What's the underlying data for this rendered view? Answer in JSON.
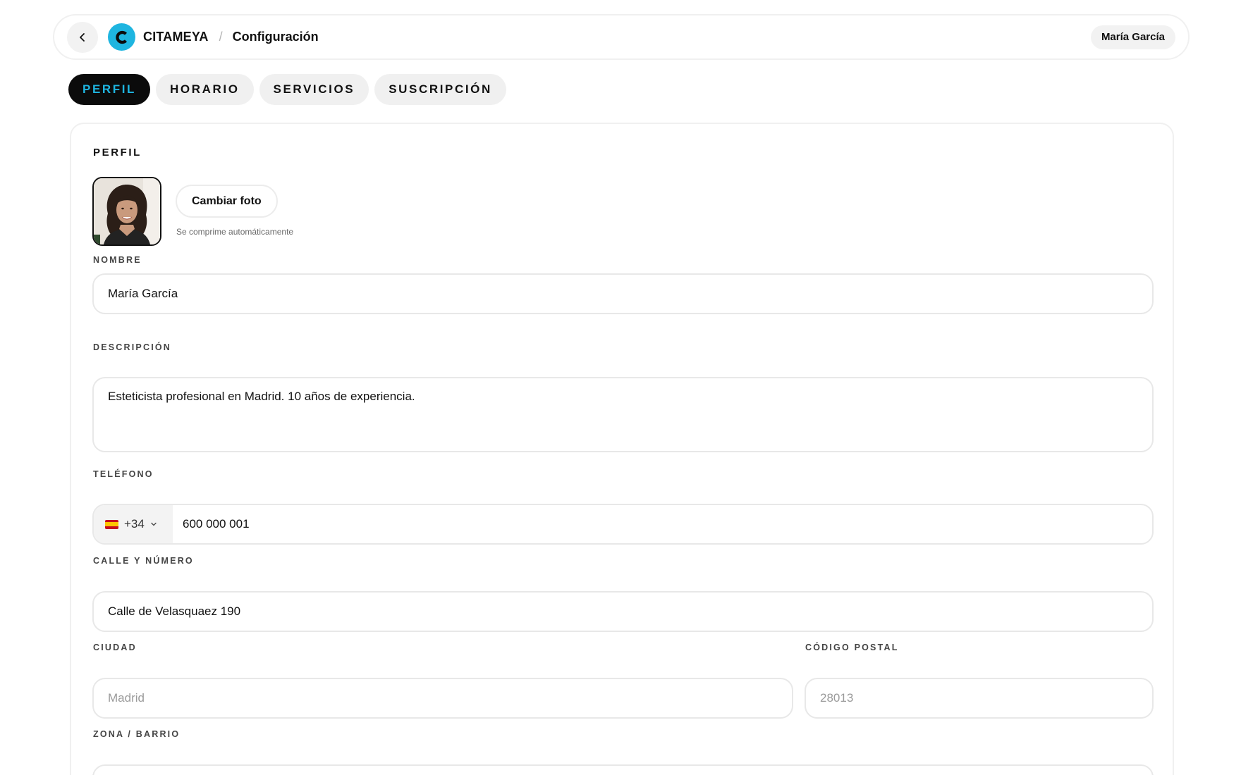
{
  "navbar": {
    "brand": "CITAMEYA",
    "logo_letter": "C",
    "separator": "/",
    "page": "Configuración",
    "user": "María García",
    "accent": "#1eb5e0"
  },
  "tabs": [
    {
      "label": "PERFIL",
      "active": true
    },
    {
      "label": "HORARIO",
      "active": false
    },
    {
      "label": "SERVICIOS",
      "active": false
    },
    {
      "label": "SUSCRIPCIÓN",
      "active": false
    }
  ],
  "profile": {
    "section_title": "PERFIL",
    "change_photo_label": "Cambiar foto",
    "photo_hint": "Se comprime automáticamente",
    "fields": {
      "nombre": {
        "label": "NOMBRE",
        "value": "María García"
      },
      "descripcion": {
        "label": "DESCRIPCIÓN",
        "value": "Esteticista profesional en Madrid. 10 años de experiencia."
      },
      "telefono": {
        "label": "TELÉFONO",
        "country_code": "+34",
        "country_flag": "es-flag-icon",
        "value": "600 000 001"
      },
      "calle": {
        "label": "CALLE Y NÚMERO",
        "value": "Calle de Velasquaez 190"
      },
      "ciudad": {
        "label": "CIUDAD",
        "placeholder": "Madrid"
      },
      "codigo_postal": {
        "label": "CÓDIGO POSTAL",
        "placeholder": "28013"
      },
      "zona": {
        "label": "ZONA / BARRIO",
        "placeholder": ""
      }
    }
  }
}
